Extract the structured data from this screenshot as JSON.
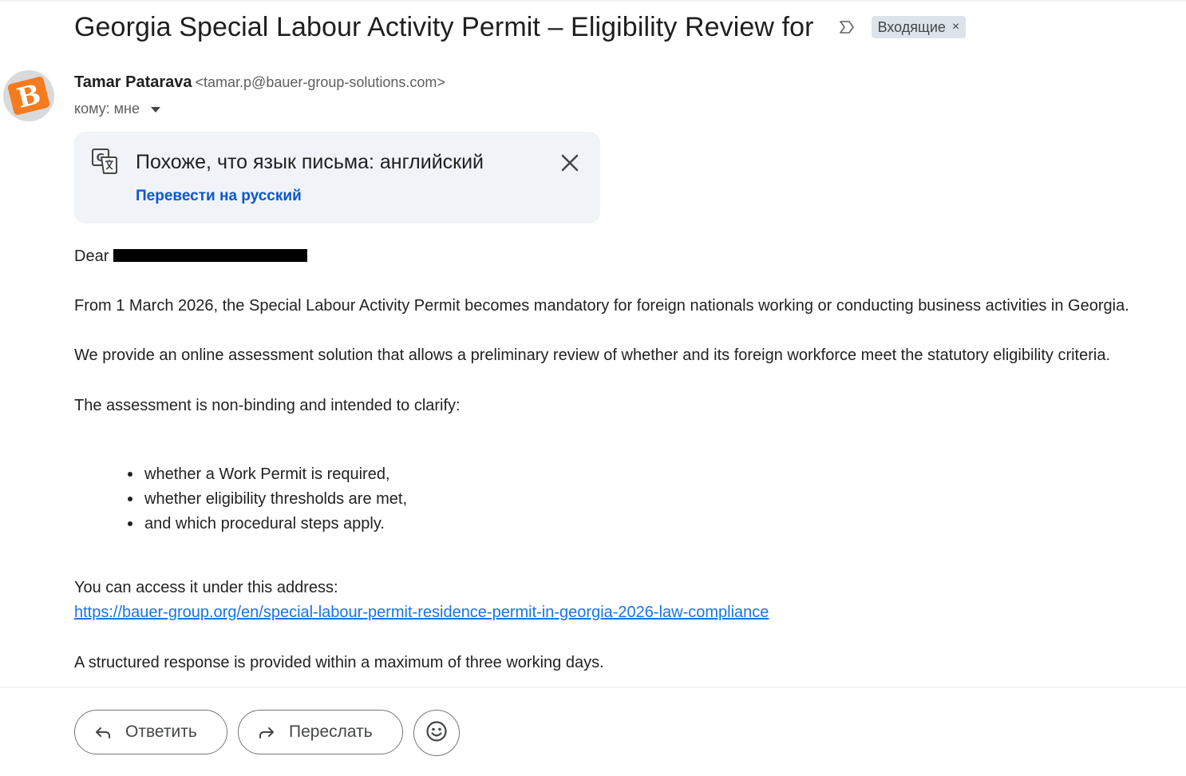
{
  "header": {
    "subject": "Georgia Special Labour Activity Permit – Eligibility Review for",
    "label_chip": "Входящие",
    "label_remove": "×"
  },
  "sender": {
    "name": "Tamar Patarava",
    "email": "<tamar.p@bauer-group-solutions.com>",
    "to_line": "кому: мне",
    "avatar_letter": "B"
  },
  "translate_banner": {
    "title": "Похоже, что язык письма: английский",
    "action": "Перевести на русский"
  },
  "message": {
    "greeting": "Dear",
    "p1": "From 1 March 2026, the Special Labour Activity Permit becomes mandatory for foreign nationals working or conducting business activities in Georgia.",
    "p2": "We provide an online assessment solution that allows a preliminary review of whether  and its foreign workforce meet the statutory eligibility criteria.",
    "p3": "The assessment is non-binding and intended to clarify:",
    "bullets": [
      "whether a Work Permit is required,",
      "whether eligibility thresholds are met,",
      "and which procedural steps apply."
    ],
    "p4": "You can access it under this address:",
    "link": "https://bauer-group.org/en/special-labour-permit-residence-permit-in-georgia-2026-law-compliance",
    "p5": "A structured response is provided within a maximum of three working days."
  },
  "actions": {
    "reply": "Ответить",
    "forward": "Переслать"
  },
  "colors": {
    "link": "#1a73e8",
    "banner_bg": "#f0f4f9",
    "banner_link": "#0b57d0",
    "avatar_orange": "#f47b20"
  },
  "icons": [
    "important-marker-icon",
    "translate-icon",
    "close-icon",
    "reply-icon",
    "forward-icon",
    "emoji-icon"
  ]
}
